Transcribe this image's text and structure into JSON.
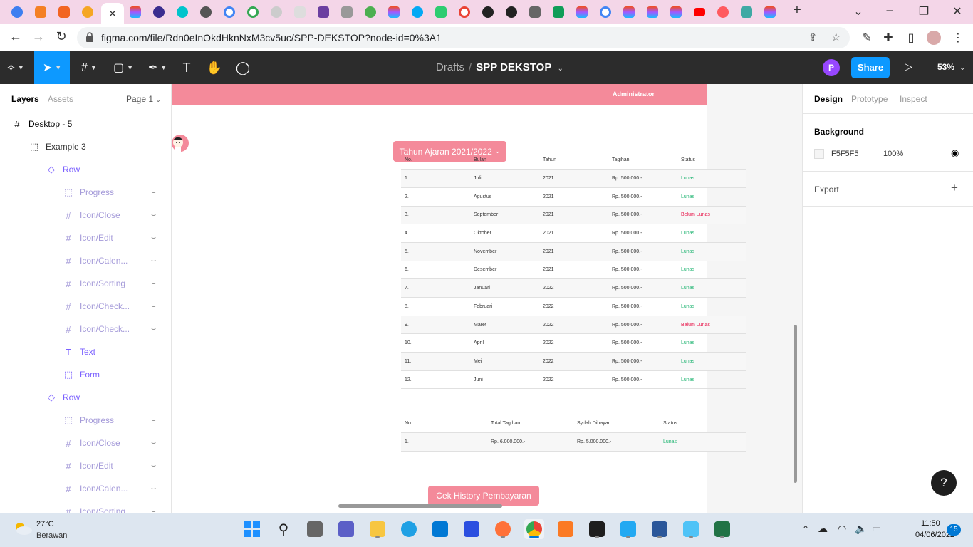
{
  "browser": {
    "tabs_active_close": "✕",
    "new_tab": "+",
    "url": "figma.com/file/Rdn0eInOkdHknNxM3cv5uc/SPP-DEKSTOP?node-id=0%3A1"
  },
  "figma": {
    "breadcrumb_drafts": "Drafts",
    "breadcrumb_sep": "/",
    "file_name": "SPP DEKSTOP",
    "user_initial": "P",
    "share_label": "Share",
    "zoom": "53%"
  },
  "left_panel": {
    "tab_layers": "Layers",
    "tab_assets": "Assets",
    "page": "Page 1",
    "layers": [
      {
        "name": "Desktop - 5",
        "icon": "frame-icon",
        "glyph": "#",
        "indent": 0,
        "color": "#000"
      },
      {
        "name": "Example 3",
        "icon": "group-dashed-icon",
        "glyph": "⬚",
        "indent": 1,
        "color": "#333"
      },
      {
        "name": "Row",
        "icon": "component-icon",
        "glyph": "◇",
        "indent": 2,
        "color": "#7b61ff"
      },
      {
        "name": "Progress",
        "icon": "group-dashed-icon",
        "glyph": "⬚",
        "indent": 3,
        "color": "#a59bd9"
      },
      {
        "name": "Icon/Close",
        "icon": "frame-icon",
        "glyph": "#",
        "indent": 3,
        "color": "#a59bd9"
      },
      {
        "name": "Icon/Edit",
        "icon": "frame-icon",
        "glyph": "#",
        "indent": 3,
        "color": "#a59bd9"
      },
      {
        "name": "Icon/Calen...",
        "icon": "frame-icon",
        "glyph": "#",
        "indent": 3,
        "color": "#a59bd9"
      },
      {
        "name": "Icon/Sorting",
        "icon": "frame-icon",
        "glyph": "#",
        "indent": 3,
        "color": "#a59bd9"
      },
      {
        "name": "Icon/Check...",
        "icon": "frame-icon",
        "glyph": "#",
        "indent": 3,
        "color": "#a59bd9"
      },
      {
        "name": "Icon/Check...",
        "icon": "frame-icon",
        "glyph": "#",
        "indent": 3,
        "color": "#a59bd9"
      },
      {
        "name": "Text",
        "icon": "text-icon",
        "glyph": "T",
        "indent": 3,
        "color": "#7b61ff"
      },
      {
        "name": "Form",
        "icon": "group-dashed-icon",
        "glyph": "⬚",
        "indent": 3,
        "color": "#7b61ff"
      },
      {
        "name": "Row",
        "icon": "component-icon",
        "glyph": "◇",
        "indent": 2,
        "color": "#7b61ff"
      },
      {
        "name": "Progress",
        "icon": "group-dashed-icon",
        "glyph": "⬚",
        "indent": 3,
        "color": "#a59bd9"
      },
      {
        "name": "Icon/Close",
        "icon": "frame-icon",
        "glyph": "#",
        "indent": 3,
        "color": "#a59bd9"
      },
      {
        "name": "Icon/Edit",
        "icon": "frame-icon",
        "glyph": "#",
        "indent": 3,
        "color": "#a59bd9"
      },
      {
        "name": "Icon/Calen...",
        "icon": "frame-icon",
        "glyph": "#",
        "indent": 3,
        "color": "#a59bd9"
      },
      {
        "name": "Icon/Sorting",
        "icon": "frame-icon",
        "glyph": "#",
        "indent": 3,
        "color": "#a59bd9"
      }
    ]
  },
  "canvas": {
    "header_user": "Administrator",
    "year_button": "Tahun Ajaran 2021/2022",
    "bill_table": {
      "headers": [
        "No.",
        "Bulan",
        "Tahun",
        "Tagihan",
        "Status"
      ],
      "rows": [
        [
          "1.",
          "Juli",
          "2021",
          "Rp. 500.000.-",
          "Lunas"
        ],
        [
          "2.",
          "Agustus",
          "2021",
          "Rp. 500.000.-",
          "Lunas"
        ],
        [
          "3.",
          "September",
          "2021",
          "Rp. 500.000.-",
          "Belum Lunas"
        ],
        [
          "4.",
          "Oktober",
          "2021",
          "Rp. 500.000.-",
          "Lunas"
        ],
        [
          "5.",
          "November",
          "2021",
          "Rp. 500.000.-",
          "Lunas"
        ],
        [
          "6.",
          "Desember",
          "2021",
          "Rp. 500.000.-",
          "Lunas"
        ],
        [
          "7.",
          "Januari",
          "2022",
          "Rp. 500.000.-",
          "Lunas"
        ],
        [
          "8.",
          "Februari",
          "2022",
          "Rp. 500.000.-",
          "Lunas"
        ],
        [
          "9.",
          "Maret",
          "2022",
          "Rp. 500.000.-",
          "Belum Lunas"
        ],
        [
          "10.",
          "April",
          "2022",
          "Rp. 500.000.-",
          "Lunas"
        ],
        [
          "11.",
          "Mei",
          "2022",
          "Rp. 500.000.-",
          "Lunas"
        ],
        [
          "12.",
          "Juni",
          "2022",
          "Rp. 500.000.-",
          "Lunas"
        ]
      ]
    },
    "summary_table": {
      "headers": [
        "No.",
        "Total Tagihan",
        "Sydah Dibayar",
        "Status"
      ],
      "rows": [
        [
          "1.",
          "Rp. 6.000.000.-",
          "Rp. 5.000.000.-",
          "Lunas"
        ]
      ]
    },
    "history_button": "Cek History Pembayaran"
  },
  "right_panel": {
    "tab_design": "Design",
    "tab_prototype": "Prototype",
    "tab_inspect": "Inspect",
    "background_label": "Background",
    "background_hex": "F5F5F5",
    "background_opacity": "100%",
    "export_label": "Export",
    "help": "?"
  },
  "taskbar": {
    "weather_temp": "27°C",
    "weather_desc": "Berawan",
    "time": "11:50",
    "date": "04/06/2022",
    "notif_count": "15"
  },
  "colors": {
    "accent_pink": "#f48a9a",
    "figma_blue": "#0d99ff",
    "lunas_green": "#22b573",
    "belum_red": "#e8174b"
  }
}
